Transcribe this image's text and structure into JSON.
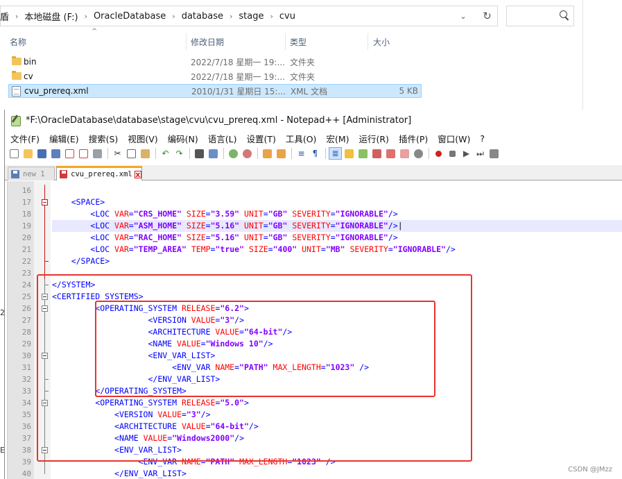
{
  "explorer": {
    "breadcrumb_lead": "盾",
    "breadcrumb": [
      "本地磁盘 (F:)",
      "OracleDatabase",
      "database",
      "stage",
      "cvu"
    ],
    "dropdown_glyph": "⌄",
    "refresh_glyph": "↻",
    "columns": {
      "name": "名称",
      "date": "修改日期",
      "type": "类型",
      "size": "大小"
    },
    "files": [
      {
        "name": "bin",
        "date": "2022/7/18 星期一 19:...",
        "type": "文件夹",
        "size": "",
        "icon": "folder-icon"
      },
      {
        "name": "cv",
        "date": "2022/7/18 星期一 19:...",
        "type": "文件夹",
        "size": "",
        "icon": "folder-icon"
      },
      {
        "name": "cvu_prereq.xml",
        "date": "2010/1/31 星期日 15:...",
        "type": "XML 文档",
        "size": "5 KB",
        "icon": "xml-file-icon",
        "selected": true
      }
    ],
    "side_glyphs": [
      "2",
      "E"
    ]
  },
  "notepad": {
    "title": "*F:\\OracleDatabase\\database\\stage\\cvu\\cvu_prereq.xml - Notepad++ [Administrator]",
    "menu": [
      "文件(F)",
      "编辑(E)",
      "搜索(S)",
      "视图(V)",
      "编码(N)",
      "语言(L)",
      "设置(T)",
      "工具(O)",
      "宏(M)",
      "运行(R)",
      "插件(P)",
      "窗口(W)",
      "?"
    ],
    "tabs": [
      {
        "label": "new 1",
        "active": false
      },
      {
        "label": "cvu_prereq.xml",
        "active": true,
        "close": "x"
      }
    ],
    "current_line": "19",
    "lines": [
      {
        "num": "16",
        "tokens": []
      },
      {
        "num": "17",
        "tokens": [
          [
            "p",
            "    "
          ],
          [
            "t",
            "<SPACE>"
          ]
        ]
      },
      {
        "num": "18",
        "tokens": [
          [
            "p",
            "        "
          ],
          [
            "t",
            "<LOC "
          ],
          [
            "a",
            "VAR"
          ],
          [
            "t",
            "="
          ],
          [
            "v",
            "\"CRS_HOME\""
          ],
          [
            "t",
            " "
          ],
          [
            "a",
            "SIZE"
          ],
          [
            "t",
            "="
          ],
          [
            "v",
            "\"3.59\""
          ],
          [
            "t",
            " "
          ],
          [
            "a",
            "UNIT"
          ],
          [
            "t",
            "="
          ],
          [
            "v",
            "\"GB\""
          ],
          [
            "t",
            " "
          ],
          [
            "a",
            "SEVERITY"
          ],
          [
            "t",
            "="
          ],
          [
            "v",
            "\"IGNORABLE\""
          ],
          [
            "t",
            "/>"
          ]
        ]
      },
      {
        "num": "19",
        "tokens": [
          [
            "p",
            "        "
          ],
          [
            "t",
            "<LOC "
          ],
          [
            "a",
            "VAR"
          ],
          [
            "t",
            "="
          ],
          [
            "v",
            "\"ASM_HOME\""
          ],
          [
            "t",
            " "
          ],
          [
            "a",
            "SIZE"
          ],
          [
            "t",
            "="
          ],
          [
            "v",
            "\"5.16\""
          ],
          [
            "t",
            " "
          ],
          [
            "a",
            "UNIT"
          ],
          [
            "t",
            "="
          ],
          [
            "v",
            "\"GB\""
          ],
          [
            "t",
            " "
          ],
          [
            "a",
            "SEVERITY"
          ],
          [
            "t",
            "="
          ],
          [
            "v",
            "\"IGNORABLE\""
          ],
          [
            "t",
            "/>"
          ],
          [
            "p",
            "|"
          ]
        ]
      },
      {
        "num": "20",
        "tokens": [
          [
            "p",
            "        "
          ],
          [
            "t",
            "<LOC "
          ],
          [
            "a",
            "VAR"
          ],
          [
            "t",
            "="
          ],
          [
            "v",
            "\"RAC_HOME\""
          ],
          [
            "t",
            " "
          ],
          [
            "a",
            "SIZE"
          ],
          [
            "t",
            "="
          ],
          [
            "v",
            "\"5.16\""
          ],
          [
            "t",
            " "
          ],
          [
            "a",
            "UNIT"
          ],
          [
            "t",
            "="
          ],
          [
            "v",
            "\"GB\""
          ],
          [
            "t",
            " "
          ],
          [
            "a",
            "SEVERITY"
          ],
          [
            "t",
            "="
          ],
          [
            "v",
            "\"IGNORABLE\""
          ],
          [
            "t",
            "/>"
          ]
        ]
      },
      {
        "num": "21",
        "tokens": [
          [
            "p",
            "        "
          ],
          [
            "t",
            "<LOC "
          ],
          [
            "a",
            "VAR"
          ],
          [
            "t",
            "="
          ],
          [
            "v",
            "\"TEMP_AREA\""
          ],
          [
            "t",
            " "
          ],
          [
            "a",
            "TEMP"
          ],
          [
            "t",
            "="
          ],
          [
            "v",
            "\"true\""
          ],
          [
            "t",
            " "
          ],
          [
            "a",
            "SIZE"
          ],
          [
            "t",
            "="
          ],
          [
            "v",
            "\"400\""
          ],
          [
            "t",
            " "
          ],
          [
            "a",
            "UNIT"
          ],
          [
            "t",
            "="
          ],
          [
            "v",
            "\"MB\""
          ],
          [
            "t",
            " "
          ],
          [
            "a",
            "SEVERITY"
          ],
          [
            "t",
            "="
          ],
          [
            "v",
            "\"IGNORABLE\""
          ],
          [
            "t",
            "/>"
          ]
        ]
      },
      {
        "num": "22",
        "tokens": [
          [
            "p",
            "    "
          ],
          [
            "t",
            "</SPACE>"
          ]
        ]
      },
      {
        "num": "23",
        "tokens": []
      },
      {
        "num": "24",
        "tokens": [
          [
            "t",
            "</SYSTEM>"
          ]
        ]
      },
      {
        "num": "25",
        "tokens": [
          [
            "t",
            "<CERTIFIED_SYSTEMS>"
          ]
        ]
      },
      {
        "num": "26",
        "tokens": [
          [
            "p",
            "         "
          ],
          [
            "t",
            "<OPERATING_SYSTEM "
          ],
          [
            "a",
            "RELEASE"
          ],
          [
            "t",
            "="
          ],
          [
            "v",
            "\"6.2\""
          ],
          [
            "t",
            ">"
          ]
        ]
      },
      {
        "num": "27",
        "tokens": [
          [
            "p",
            "                    "
          ],
          [
            "t",
            "<VERSION "
          ],
          [
            "a",
            "VALUE"
          ],
          [
            "t",
            "="
          ],
          [
            "v",
            "\"3\""
          ],
          [
            "t",
            "/>"
          ]
        ]
      },
      {
        "num": "28",
        "tokens": [
          [
            "p",
            "                    "
          ],
          [
            "t",
            "<ARCHITECTURE "
          ],
          [
            "a",
            "VALUE"
          ],
          [
            "t",
            "="
          ],
          [
            "v",
            "\"64-bit\""
          ],
          [
            "t",
            "/>"
          ]
        ]
      },
      {
        "num": "29",
        "tokens": [
          [
            "p",
            "                    "
          ],
          [
            "t",
            "<NAME "
          ],
          [
            "a",
            "VALUE"
          ],
          [
            "t",
            "="
          ],
          [
            "v",
            "\"Windows 10\""
          ],
          [
            "t",
            "/>"
          ]
        ]
      },
      {
        "num": "30",
        "tokens": [
          [
            "p",
            "                    "
          ],
          [
            "t",
            "<ENV_VAR_LIST>"
          ]
        ]
      },
      {
        "num": "31",
        "tokens": [
          [
            "p",
            "                         "
          ],
          [
            "t",
            "<ENV_VAR "
          ],
          [
            "a",
            "NAME"
          ],
          [
            "t",
            "="
          ],
          [
            "v",
            "\"PATH\""
          ],
          [
            "t",
            " "
          ],
          [
            "a",
            "MAX_LENGTH"
          ],
          [
            "t",
            "="
          ],
          [
            "v",
            "\"1023\""
          ],
          [
            "t",
            " />"
          ]
        ]
      },
      {
        "num": "32",
        "tokens": [
          [
            "p",
            "                    "
          ],
          [
            "t",
            "</ENV_VAR_LIST>"
          ]
        ]
      },
      {
        "num": "33",
        "tokens": [
          [
            "p",
            "         "
          ],
          [
            "t",
            "</OPERATING_SYSTEM>"
          ]
        ]
      },
      {
        "num": "34",
        "tokens": [
          [
            "p",
            "         "
          ],
          [
            "t",
            "<OPERATING_SYSTEM "
          ],
          [
            "a",
            "RELEASE"
          ],
          [
            "t",
            "="
          ],
          [
            "v",
            "\"5.0\""
          ],
          [
            "t",
            ">"
          ]
        ]
      },
      {
        "num": "35",
        "tokens": [
          [
            "p",
            "             "
          ],
          [
            "t",
            "<VERSION "
          ],
          [
            "a",
            "VALUE"
          ],
          [
            "t",
            "="
          ],
          [
            "v",
            "\"3\""
          ],
          [
            "t",
            "/>"
          ]
        ]
      },
      {
        "num": "36",
        "tokens": [
          [
            "p",
            "             "
          ],
          [
            "t",
            "<ARCHITECTURE "
          ],
          [
            "a",
            "VALUE"
          ],
          [
            "t",
            "="
          ],
          [
            "v",
            "\"64-bit\""
          ],
          [
            "t",
            "/>"
          ]
        ]
      },
      {
        "num": "37",
        "tokens": [
          [
            "p",
            "             "
          ],
          [
            "t",
            "<NAME "
          ],
          [
            "a",
            "VALUE"
          ],
          [
            "t",
            "="
          ],
          [
            "v",
            "\"Windows2000\""
          ],
          [
            "t",
            "/>"
          ]
        ]
      },
      {
        "num": "38",
        "tokens": [
          [
            "p",
            "             "
          ],
          [
            "t",
            "<ENV_VAR_LIST>"
          ]
        ]
      },
      {
        "num": "39",
        "tokens": [
          [
            "p",
            "                  "
          ],
          [
            "t",
            "<ENV_VAR "
          ],
          [
            "a",
            "NAME"
          ],
          [
            "t",
            "="
          ],
          [
            "v",
            "\"PATH\""
          ],
          [
            "t",
            " "
          ],
          [
            "a",
            "MAX_LENGTH"
          ],
          [
            "t",
            "="
          ],
          [
            "v",
            "\"1023\""
          ],
          [
            "t",
            " />"
          ]
        ]
      },
      {
        "num": "40",
        "tokens": [
          [
            "p",
            "             "
          ],
          [
            "t",
            "</ENV_VAR_LIST>"
          ]
        ]
      }
    ],
    "colors": {
      "tag": "#0000ff",
      "attr": "#ff0000",
      "value": "#8000ff",
      "highlight_box": "#e8322e",
      "current_line_bg": "#e8e8ff"
    }
  },
  "watermark": "CSDN @JMzz"
}
